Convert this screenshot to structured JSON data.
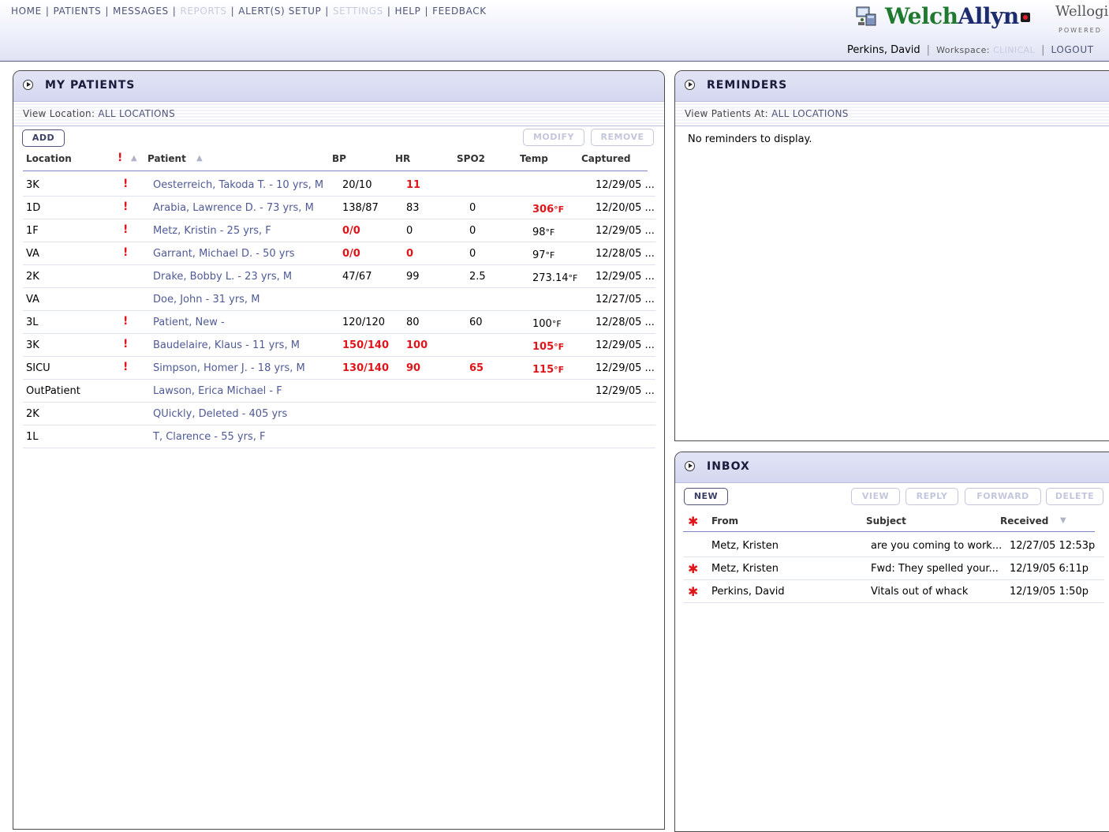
{
  "nav": {
    "items": [
      {
        "label": "HOME",
        "enabled": true
      },
      {
        "label": "PATIENTS",
        "enabled": true
      },
      {
        "label": "MESSAGES",
        "enabled": true
      },
      {
        "label": "REPORTS",
        "enabled": false
      },
      {
        "label": "ALERT(S) SETUP",
        "enabled": true
      },
      {
        "label": "SETTINGS",
        "enabled": false
      },
      {
        "label": "HELP",
        "enabled": true
      },
      {
        "label": "FEEDBACK",
        "enabled": true
      }
    ],
    "separator": "|"
  },
  "brand": {
    "name_part1": "Welch",
    "name_part2": "Allyn",
    "partner": "Wellogic",
    "powered": "POWERED"
  },
  "user": {
    "name": "Perkins, David",
    "workspace_label": "Workspace:",
    "workspace_value": "CLINICAL",
    "logout": "LOGOUT"
  },
  "patients_panel": {
    "title": "MY PATIENTS",
    "location_label": "View Location:",
    "location_value": "ALL LOCATIONS",
    "buttons": {
      "add": "ADD",
      "modify": "MODIFY",
      "remove": "REMOVE"
    },
    "columns": {
      "location": "Location",
      "patient": "Patient",
      "bp": "BP",
      "hr": "HR",
      "spo2": "SPO2",
      "temp": "Temp",
      "captured": "Captured"
    },
    "temp_unit": "°F",
    "rows": [
      {
        "location": "3K",
        "alert": true,
        "patient": "Oesterreich, Takoda T. - 10 yrs, M",
        "bp": "20/10",
        "bp_alert": false,
        "hr": "11",
        "hr_alert": true,
        "spo2": "",
        "spo2_alert": false,
        "temp": "",
        "temp_alert": false,
        "captured": "12/29/05 ..."
      },
      {
        "location": "1D",
        "alert": true,
        "patient": "Arabia, Lawrence D. - 73 yrs, M",
        "bp": "138/87",
        "bp_alert": false,
        "hr": "83",
        "hr_alert": false,
        "spo2": "0",
        "spo2_alert": false,
        "temp": "306",
        "temp_alert": true,
        "captured": "12/20/05 ..."
      },
      {
        "location": "1F",
        "alert": true,
        "patient": "Metz, Kristin - 25 yrs, F",
        "bp": "0/0",
        "bp_alert": true,
        "hr": "0",
        "hr_alert": false,
        "spo2": "0",
        "spo2_alert": false,
        "temp": "98",
        "temp_alert": false,
        "captured": "12/29/05 ..."
      },
      {
        "location": "VA",
        "alert": true,
        "patient": "Garrant, Michael D. - 50 yrs",
        "bp": "0/0",
        "bp_alert": true,
        "hr": "0",
        "hr_alert": true,
        "spo2": "0",
        "spo2_alert": false,
        "temp": "97",
        "temp_alert": false,
        "captured": "12/28/05 ..."
      },
      {
        "location": "2K",
        "alert": false,
        "patient": "Drake, Bobby L. - 23 yrs, M",
        "bp": "47/67",
        "bp_alert": false,
        "hr": "99",
        "hr_alert": false,
        "spo2": "2.5",
        "spo2_alert": false,
        "temp": "273.14",
        "temp_alert": false,
        "captured": "12/29/05 ..."
      },
      {
        "location": "VA",
        "alert": false,
        "patient": "Doe, John - 31 yrs, M",
        "bp": "",
        "bp_alert": false,
        "hr": "",
        "hr_alert": false,
        "spo2": "",
        "spo2_alert": false,
        "temp": "",
        "temp_alert": false,
        "captured": "12/27/05 ..."
      },
      {
        "location": "3L",
        "alert": true,
        "patient": "Patient, New -",
        "bp": "120/120",
        "bp_alert": false,
        "hr": "80",
        "hr_alert": false,
        "spo2": "60",
        "spo2_alert": false,
        "temp": "100",
        "temp_alert": false,
        "captured": "12/28/05 ..."
      },
      {
        "location": "3K",
        "alert": true,
        "patient": "Baudelaire, Klaus - 11 yrs, M",
        "bp": "150/140",
        "bp_alert": true,
        "hr": "100",
        "hr_alert": true,
        "spo2": "",
        "spo2_alert": false,
        "temp": "105",
        "temp_alert": true,
        "captured": "12/29/05 ..."
      },
      {
        "location": "SICU",
        "alert": true,
        "patient": "Simpson, Homer J. - 18 yrs, M",
        "bp": "130/140",
        "bp_alert": true,
        "hr": "90",
        "hr_alert": true,
        "spo2": "65",
        "spo2_alert": true,
        "temp": "115",
        "temp_alert": true,
        "captured": "12/29/05 ..."
      },
      {
        "location": "OutPatient",
        "alert": false,
        "patient": "Lawson, Erica Michael - F",
        "bp": "",
        "bp_alert": false,
        "hr": "",
        "hr_alert": false,
        "spo2": "",
        "spo2_alert": false,
        "temp": "",
        "temp_alert": false,
        "captured": "12/29/05 ..."
      },
      {
        "location": "2K",
        "alert": false,
        "patient": "QUickly, Deleted - 405 yrs",
        "bp": "",
        "bp_alert": false,
        "hr": "",
        "hr_alert": false,
        "spo2": "",
        "spo2_alert": false,
        "temp": "",
        "temp_alert": false,
        "captured": ""
      },
      {
        "location": "1L",
        "alert": false,
        "patient": "T, Clarence - 55 yrs, F",
        "bp": "",
        "bp_alert": false,
        "hr": "",
        "hr_alert": false,
        "spo2": "",
        "spo2_alert": false,
        "temp": "",
        "temp_alert": false,
        "captured": ""
      }
    ]
  },
  "reminders_panel": {
    "title": "REMINDERS",
    "location_label": "View Patients At:",
    "location_value": "ALL LOCATIONS",
    "empty_text": "No reminders to display."
  },
  "inbox_panel": {
    "title": "INBOX",
    "buttons": {
      "new": "NEW",
      "view": "VIEW",
      "reply": "REPLY",
      "forward": "FORWARD",
      "delete": "DELETE"
    },
    "columns": {
      "from": "From",
      "subject": "Subject",
      "received": "Received"
    },
    "messages": [
      {
        "unread": false,
        "from": "Metz, Kristen",
        "subject": "are you coming to work...",
        "received": "12/27/05 12:53p"
      },
      {
        "unread": true,
        "from": "Metz, Kristen",
        "subject": "Fwd: They spelled your...",
        "received": "12/19/05 6:11p"
      },
      {
        "unread": true,
        "from": "Perkins, David",
        "subject": "Vitals out of whack",
        "received": "12/19/05 1:50p"
      }
    ]
  },
  "colors": {
    "alert_red": "#e0151a",
    "link_blue": "#4f5a96",
    "nav_blue": "#4f5478",
    "disabled_gray": "#c8cbe0",
    "brand_green": "#1f7a2f"
  }
}
